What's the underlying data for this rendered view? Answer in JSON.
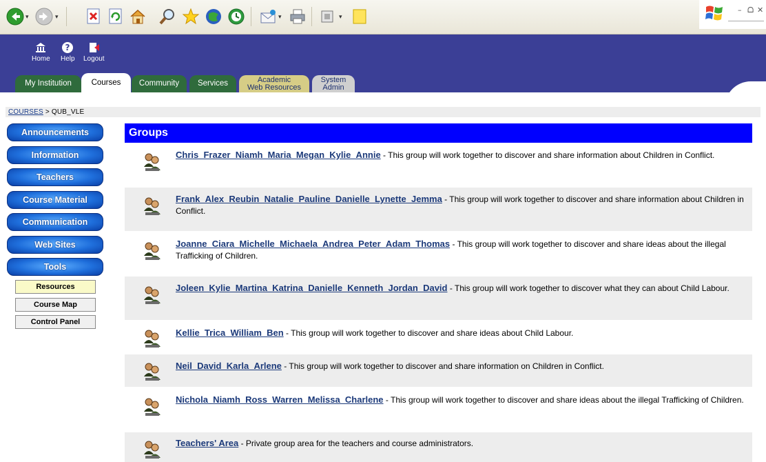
{
  "browser": {
    "dropdown_glyph": "▾",
    "window_controls": {
      "minimize": "–",
      "restore": "ᗝ",
      "close": "✕"
    }
  },
  "nav": {
    "home_label": "Home",
    "help_label": "Help",
    "logout_label": "Logout"
  },
  "tabs": {
    "my_institution": "My Institution",
    "courses": "Courses",
    "community": "Community",
    "services": "Services",
    "academic_l1": "Academic",
    "academic_l2": "Web Resources",
    "system_l1": "System",
    "system_l2": "Admin"
  },
  "breadcrumb": {
    "root": "COURSES",
    "separator": " > ",
    "current": "QUB_VLE"
  },
  "menu": {
    "announcements": "Announcements",
    "information": "Information",
    "teachers": "Teachers",
    "course_material": "Course Material",
    "communication": "Communication",
    "web_sites": "Web Sites",
    "tools": "Tools",
    "resources": "Resources",
    "course_map": "Course Map",
    "control_panel": "Control Panel"
  },
  "content": {
    "title": "Groups",
    "groups": [
      {
        "name": "Chris_Frazer_Niamh_Maria_Megan_Kylie_Annie",
        "description": " - This group will work together to discover and share information about Children in Conflict."
      },
      {
        "name": "Frank_Alex_Reubin_Natalie_Pauline_Danielle_Lynette_Jemma",
        "description": " - This group will work together to discover and share information about Children in Conflict."
      },
      {
        "name": "Joanne_Ciara_Michelle_Michaela_Andrea_Peter_Adam_Thomas",
        "description": " - This group will work together to discover and share ideas about the illegal Trafficking of Children."
      },
      {
        "name": "Joleen_Kylie_Martina_Katrina_Danielle_Kenneth_Jordan_David",
        "description": " - This group will work together to discover what they can about Child Labour."
      },
      {
        "name": "Kellie_Trica_William_Ben",
        "description": " - This group will work together to discover and share ideas about Child Labour."
      },
      {
        "name": "Neil_David_Karla_Arlene",
        "description": " - This group will work together to discover and share information on Children in Conflict."
      },
      {
        "name": "Nichola_Niamh_Ross_Warren_Melissa_Charlene",
        "description": " - This group will work together to discover and share ideas about the illegal Trafficking of Children."
      },
      {
        "name": "Teachers' Area",
        "description": " - Private group area for the teachers and course administrators."
      }
    ]
  },
  "colors": {
    "header_bg": "#3b3f96",
    "tab_green": "#2f6b3c",
    "groups_header": "#0000ff",
    "menu_blue": "#1f6fdc",
    "link": "#1c3a7a"
  },
  "icons": {
    "toolbar": [
      "back-icon",
      "forward-icon",
      "stop-icon",
      "refresh-icon",
      "home-icon",
      "search-icon",
      "favorites-icon",
      "media-icon",
      "history-icon",
      "mail-icon",
      "print-icon",
      "edit-icon",
      "note-icon"
    ],
    "group": "group-people-icon"
  }
}
